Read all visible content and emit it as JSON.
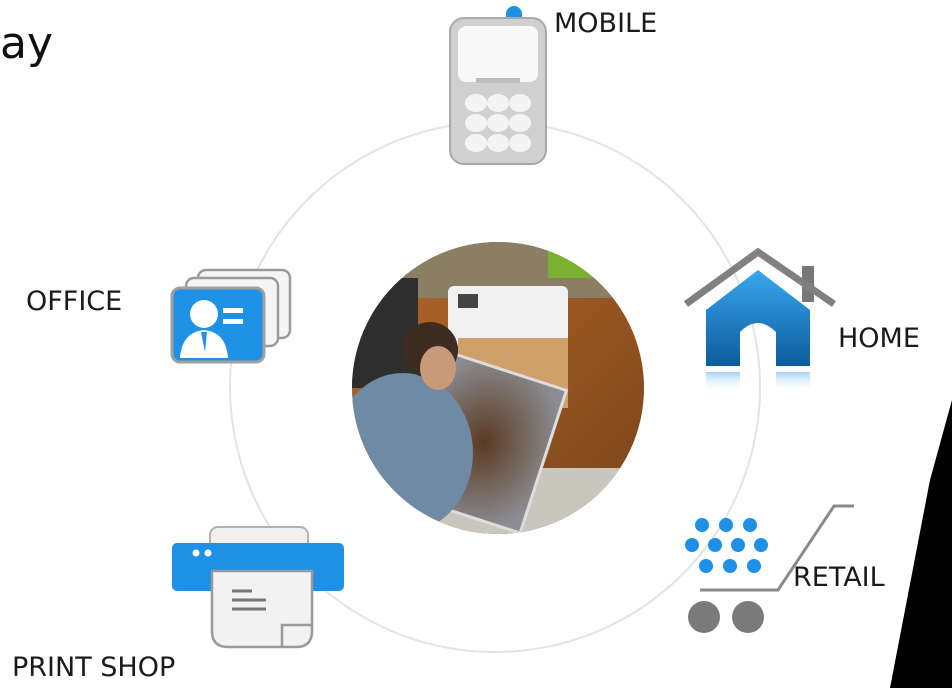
{
  "title_fragment": "ay",
  "center": {
    "photo_icon": "person-with-printer-photo-icon"
  },
  "channels": [
    {
      "id": "mobile",
      "label": "MOBILE",
      "icon": "mobile-phone-icon"
    },
    {
      "id": "home",
      "label": "HOME",
      "icon": "house-icon"
    },
    {
      "id": "retail",
      "label": "RETAIL",
      "icon": "shopping-cart-icon"
    },
    {
      "id": "print-shop",
      "label": "PRINT SHOP",
      "icon": "printer-icon"
    },
    {
      "id": "office",
      "label": "OFFICE",
      "icon": "business-card-icon"
    }
  ],
  "colors": {
    "accent_blue": "#1e90e6",
    "icon_gray": "#c9c9c9",
    "ring": "#e3e3e3",
    "corner_shape": "#000000"
  }
}
